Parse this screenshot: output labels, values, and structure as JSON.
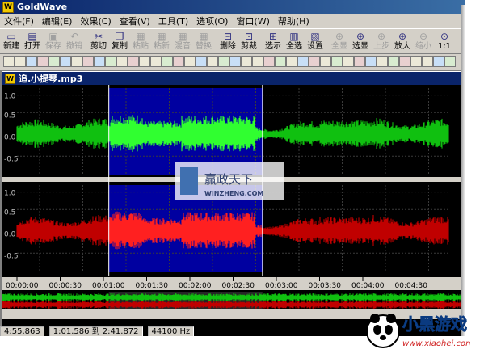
{
  "app": {
    "title": "GoldWave",
    "logo_letter": "W"
  },
  "menu": [
    "文件(F)",
    "编辑(E)",
    "效果(C)",
    "查看(V)",
    "工具(T)",
    "选项(O)",
    "窗口(W)",
    "帮助(H)"
  ],
  "toolbar": [
    {
      "label": "新建",
      "icon": "new-file-icon",
      "enabled": true
    },
    {
      "label": "打开",
      "icon": "open-folder-icon",
      "enabled": true
    },
    {
      "label": "保存",
      "icon": "save-icon",
      "enabled": false
    },
    {
      "label": "撤销",
      "icon": "undo-icon",
      "enabled": false
    },
    {
      "label": "剪切",
      "icon": "cut-icon",
      "enabled": true
    },
    {
      "label": "复制",
      "icon": "copy-icon",
      "enabled": true
    },
    {
      "label": "粘贴",
      "icon": "paste-icon",
      "enabled": false
    },
    {
      "label": "粘新",
      "icon": "paste-new-icon",
      "enabled": false
    },
    {
      "label": "混音",
      "icon": "mix-icon",
      "enabled": false
    },
    {
      "label": "替换",
      "icon": "replace-icon",
      "enabled": false
    },
    {
      "label": "删除",
      "icon": "delete-icon",
      "enabled": true
    },
    {
      "label": "剪裁",
      "icon": "trim-icon",
      "enabled": true
    },
    {
      "label": "选示",
      "icon": "select-view-icon",
      "enabled": true
    },
    {
      "label": "全选",
      "icon": "select-all-icon",
      "enabled": true
    },
    {
      "label": "设置",
      "icon": "settings-icon",
      "enabled": true
    },
    {
      "label": "全显",
      "icon": "zoom-all-icon",
      "enabled": false
    },
    {
      "label": "选显",
      "icon": "zoom-selection-icon",
      "enabled": true
    },
    {
      "label": "上步",
      "icon": "zoom-previous-icon",
      "enabled": false
    },
    {
      "label": "放大",
      "icon": "zoom-in-icon",
      "enabled": true
    },
    {
      "label": "缩小",
      "icon": "zoom-out-icon",
      "enabled": false
    },
    {
      "label": "1:1",
      "icon": "zoom-100-icon",
      "enabled": true
    }
  ],
  "document": {
    "title": "追.小提琴.mp3"
  },
  "waveform": {
    "channel_axis_labels": [
      "1.0",
      "0.5",
      "0.0",
      "-0.5"
    ],
    "time_labels": [
      "00:00:00",
      "00:00:30",
      "00:01:00",
      "00:01:30",
      "00:02:00",
      "00:02:30",
      "00:03:00",
      "00:03:30",
      "00:04:00",
      "00:04:30"
    ],
    "colors": {
      "left_channel": "#10c010",
      "left_selected": "#30ff30",
      "right_channel": "#c00000",
      "right_selected": "#ff2020",
      "selection_bg": "#0000a0",
      "background": "#000000"
    },
    "selection_start_fraction": 0.2125,
    "selection_end_fraction": 0.5679
  },
  "watermark": {
    "cn": "赢政天下",
    "url": "WINZHENG.COM"
  },
  "status": {
    "length": "4:55.863",
    "selection_range": "1:01.586 到 2:41.872",
    "rate_hint": "44100 Hz"
  },
  "corner_logo": {
    "text": "小黑游戏",
    "url": "www.xiaohei.com"
  }
}
